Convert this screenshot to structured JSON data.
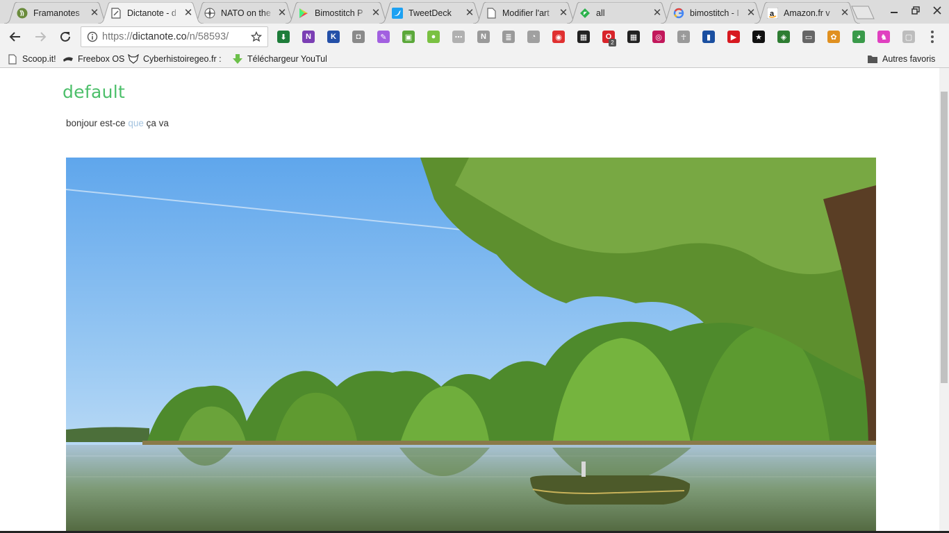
{
  "tabs": [
    {
      "title": "Framanotes",
      "icon": "framanotes-icon",
      "active": false
    },
    {
      "title": "Dictanote - d",
      "icon": "dictanote-icon",
      "active": true
    },
    {
      "title": "NATO on the",
      "icon": "nato-icon",
      "active": false
    },
    {
      "title": "Bimostitch P",
      "icon": "google-play-icon",
      "active": false
    },
    {
      "title": "TweetDeck",
      "icon": "twitter-icon",
      "active": false
    },
    {
      "title": "Modifier l'art",
      "icon": "page-icon",
      "active": false
    },
    {
      "title": "all",
      "icon": "feedly-icon",
      "active": false
    },
    {
      "title": "bimostitch - I",
      "icon": "google-icon",
      "active": false
    },
    {
      "title": "Amazon.fr v",
      "icon": "amazon-icon",
      "active": false
    }
  ],
  "omnibox": {
    "scheme": "https://",
    "host": "dictanote.co",
    "path": "/n/58593/"
  },
  "extensions": [
    {
      "name": "download-ext-icon",
      "color": "#1e7d3a",
      "glyph": "⬇"
    },
    {
      "name": "onenote-ext-icon",
      "color": "#7b3fb4",
      "glyph": "N"
    },
    {
      "name": "k-ext-icon",
      "color": "#2450a8",
      "glyph": "K"
    },
    {
      "name": "camera-ext-icon",
      "color": "#8a8a8a",
      "glyph": "◘"
    },
    {
      "name": "feather-ext-icon",
      "color": "#a260e0",
      "glyph": "✎"
    },
    {
      "name": "print-ext-icon",
      "color": "#5ba83a",
      "glyph": "▣"
    },
    {
      "name": "green-dot-ext-icon",
      "color": "#7ac142",
      "glyph": "●"
    },
    {
      "name": "gray-ext-icon",
      "color": "#b0b0b0",
      "glyph": "⋯"
    },
    {
      "name": "notion-ext-icon",
      "color": "#9a9a9a",
      "glyph": "N"
    },
    {
      "name": "stack-ext-icon",
      "color": "#9a9a9a",
      "glyph": "≣"
    },
    {
      "name": "rss-ext-icon",
      "color": "#a0a0a0",
      "glyph": "◔"
    },
    {
      "name": "broadcast-ext-icon",
      "color": "#e03030",
      "glyph": "◉"
    },
    {
      "name": "qr-ext-icon",
      "color": "#222222",
      "glyph": "▦"
    },
    {
      "name": "opera-ext-icon",
      "color": "#d8242a",
      "glyph": "O"
    },
    {
      "name": "qr2-ext-icon",
      "color": "#222222",
      "glyph": "▦"
    },
    {
      "name": "disc-ext-icon",
      "color": "#c2185b",
      "glyph": "◎"
    },
    {
      "name": "ankh-ext-icon",
      "color": "#9a9a9a",
      "glyph": "☥"
    },
    {
      "name": "book-ext-icon",
      "color": "#1a4fa0",
      "glyph": "▮"
    },
    {
      "name": "video-ext-icon",
      "color": "#d71920",
      "glyph": "▶"
    },
    {
      "name": "star-ext-icon",
      "color": "#111111",
      "glyph": "★"
    },
    {
      "name": "turtle-ext-icon",
      "color": "#2e7d32",
      "glyph": "◈"
    },
    {
      "name": "cast-ext-icon",
      "color": "#666666",
      "glyph": "▭"
    },
    {
      "name": "paint-ext-icon",
      "color": "#e09020",
      "glyph": "✿"
    },
    {
      "name": "frog-ext-icon",
      "color": "#3a9a4a",
      "glyph": "◕"
    },
    {
      "name": "unicorn-ext-icon",
      "color": "#e040c0",
      "glyph": "♞"
    },
    {
      "name": "blank-ext-icon",
      "color": "#bdbdbd",
      "glyph": "▢"
    }
  ],
  "badge_count": "2",
  "bookmarks": [
    {
      "label": "Scoop.it!",
      "icon": "page-icon"
    },
    {
      "label": "Freebox OS",
      "icon": "freebox-icon"
    },
    {
      "label": "Cyberhistoiregeo.fr : r",
      "icon": "fox-icon"
    },
    {
      "label": "Téléchargeur YouTube",
      "icon": "download-arrow-icon"
    }
  ],
  "other_bookmarks": "Autres favoris",
  "note": {
    "title": "default",
    "text_before": "bonjour est-ce ",
    "text_highlight": "que",
    "text_after": " ça va"
  },
  "colors": {
    "title_green": "#4cbf6a",
    "highlight_blue": "#a5c4e0"
  }
}
